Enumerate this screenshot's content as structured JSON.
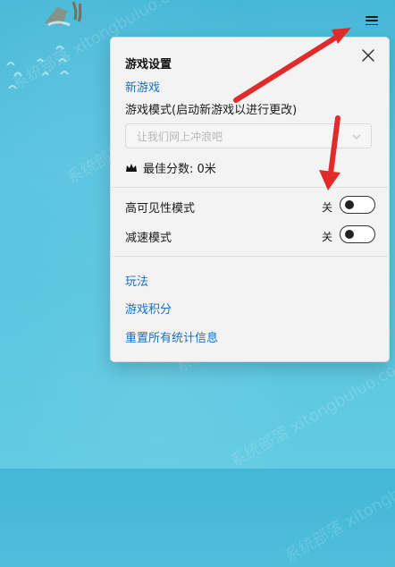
{
  "panel": {
    "title": "游戏设置",
    "new_game": "新游戏",
    "mode_label": "游戏模式(启动新游戏以进行更改)",
    "mode_select_value": "让我们网上冲浪吧",
    "best_score": "最佳分数: 0米",
    "settings": [
      {
        "label": "高可见性模式",
        "state": "关",
        "enabled": false
      },
      {
        "label": "减速模式",
        "state": "关",
        "enabled": false
      }
    ],
    "links": {
      "how_to_play": "玩法",
      "game_points": "游戏积分",
      "reset_stats": "重置所有统计信息"
    }
  },
  "watermark": {
    "rows": [
      "系统部落 xitongbuluo.com",
      "系统部落 xitongbuluo.com",
      "系统部落 xitongbuluo.com",
      "系统部落 xitongbuluo.com",
      "系统部落 xitongbuluo.com",
      "系统部落 xitongbuluo.com"
    ]
  },
  "colors": {
    "ocean": "#56c3df",
    "link": "#1a6fbf",
    "arrow": "#e12a2a",
    "panel_bg": "#f3f3f3"
  },
  "icons": {
    "menu": "hamburger-menu-icon",
    "close": "close-icon",
    "crown": "crown-icon",
    "chevron": "chevron-down-icon"
  }
}
